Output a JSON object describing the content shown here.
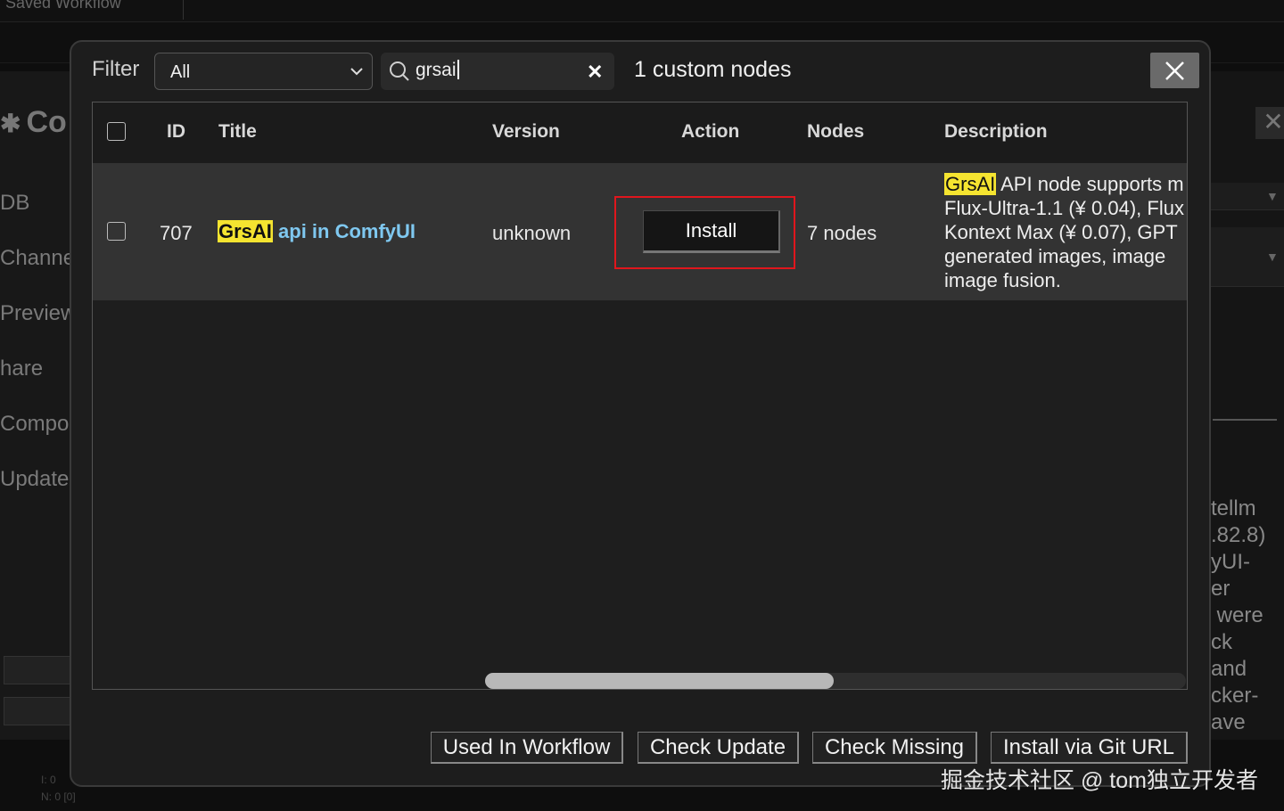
{
  "background": {
    "tab_label": "Saved Workflow",
    "left_panel": {
      "title": "Co",
      "items": [
        "DB",
        "Channe",
        "Preview",
        "hare",
        "Compor",
        "Update"
      ],
      "footer_lines": [
        "I: 0",
        "N: 0 [0]"
      ]
    },
    "right_panel": {
      "text": "tellm\n.82.8)\nyUI-\ner\n were\nck\nand\ncker-\nave"
    }
  },
  "dialog": {
    "filter_label": "Filter",
    "filter_value": "All",
    "search_value": "grsai",
    "result_count": "1 custom nodes",
    "table": {
      "columns": [
        "ID",
        "Title",
        "Version",
        "Action",
        "Nodes",
        "Description"
      ],
      "rows": [
        {
          "id": "707",
          "title_highlight": "GrsAI",
          "title_rest": " api in ComfyUI",
          "version": "unknown",
          "action": "Install",
          "nodes": "7 nodes",
          "description_highlight": "GrsAI",
          "description_lines": [
            " API node supports m",
            "Flux-Ultra-1.1 (¥ 0.04), Flux",
            "Kontext Max (¥ 0.07), GPT",
            "generated images, image",
            "image fusion."
          ]
        }
      ],
      "scroll_fraction_visible": 0.5
    },
    "footer_buttons": [
      "Used In Workflow",
      "Check Update",
      "Check Missing",
      "Install via Git URL"
    ]
  },
  "watermark": "掘金技术社区 @ tom独立开发者",
  "colors": {
    "highlight": "#f5e430",
    "link": "#7fc8f0",
    "action_frame": "#e0161d"
  }
}
